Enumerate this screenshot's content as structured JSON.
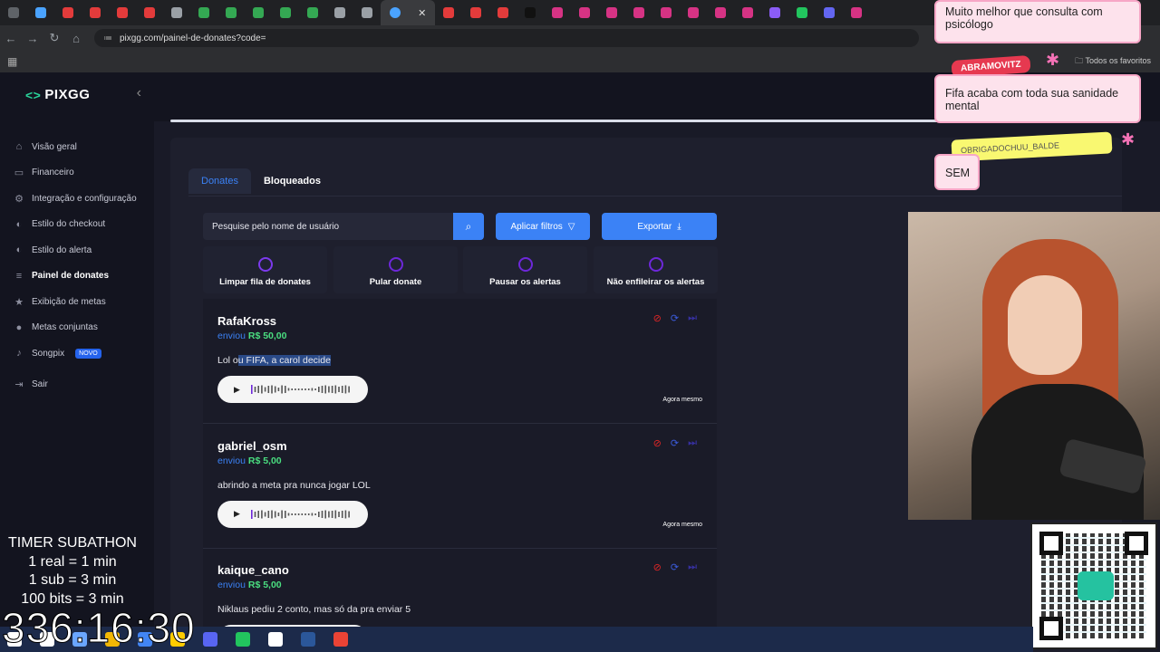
{
  "browser": {
    "url": "pixgg.com/painel-de-donates?code=",
    "bookmarks_all": "Todos os favoritos",
    "tab_colors": [
      "#5f6368",
      "#4aa3ff",
      "#e33b3b",
      "#e33b3b",
      "#e33b3b",
      "#e33b3b",
      "#9aa0a6",
      "#34a853",
      "#34a853",
      "#34a853",
      "#34a853",
      "#34a853",
      "#9aa0a6",
      "#9aa0a6",
      "#e33b3b",
      "#e33b3b",
      "#e33b3b",
      "#111111",
      "#d63384",
      "#d63384",
      "#d63384",
      "#d63384",
      "#d63384",
      "#d63384",
      "#d63384",
      "#d63384",
      "#8b5cf6",
      "#22c55e",
      "#6366f1",
      "#d63384"
    ]
  },
  "sidebar": {
    "brand": "PIXGG",
    "items": [
      {
        "label": "Visão geral",
        "icon": "home-icon",
        "glyph": "⌂"
      },
      {
        "label": "Financeiro",
        "icon": "wallet-icon",
        "glyph": "▭"
      },
      {
        "label": "Integração e configuração",
        "icon": "link-icon",
        "glyph": "⚙"
      },
      {
        "label": "Estilo do checkout",
        "icon": "palette-icon",
        "glyph": "◐"
      },
      {
        "label": "Estilo do alerta",
        "icon": "palette-icon",
        "glyph": "◐"
      },
      {
        "label": "Painel de donates",
        "icon": "list-icon",
        "glyph": "≡"
      },
      {
        "label": "Exibição de metas",
        "icon": "star-icon",
        "glyph": "★"
      },
      {
        "label": "Metas conjuntas",
        "icon": "users-icon",
        "glyph": "●"
      },
      {
        "label": "Songpix",
        "icon": "music-icon",
        "glyph": "♪",
        "badge": "NOVO"
      },
      {
        "label": "Sair",
        "icon": "logout-icon",
        "glyph": "⇥"
      }
    ],
    "active_index": 5
  },
  "panel": {
    "tabs": [
      "Donates",
      "Bloqueados"
    ],
    "search_placeholder": "Pesquise pelo nome de usuário",
    "filter_label": "Aplicar filtros",
    "export_label": "Exportar",
    "actions": [
      {
        "label": "Limpar fila de donates",
        "icon": "eraser-icon",
        "color": "#7c3aed"
      },
      {
        "label": "Pular donate",
        "icon": "skip-icon",
        "color": "#6d28d9"
      },
      {
        "label": "Pausar os alertas",
        "icon": "pause-icon",
        "color": "#6d28d9"
      },
      {
        "label": "Não enfileirar os alertas",
        "icon": "bell-off-icon",
        "color": "#6d28d9"
      }
    ],
    "donates": [
      {
        "user": "RafaKross",
        "sent": "enviou",
        "amount": "R$ 50,00",
        "msg_plain": "Lol o",
        "msg_hl": "u FIFA, a carol decide",
        "time": "Agora mesmo"
      },
      {
        "user": "gabriel_osm",
        "sent": "enviou",
        "amount": "R$ 5,00",
        "msg_plain": "abrindo a meta pra nunca jogar LOL",
        "msg_hl": "",
        "time": "Agora mesmo"
      },
      {
        "user": "kaique_cano",
        "sent": "enviou",
        "amount": "R$ 5,00",
        "msg_plain": "Niklaus pediu 2 conto, mas só da pra enviar 5",
        "msg_hl": "",
        "time": ""
      }
    ]
  },
  "overlay": {
    "chat": [
      {
        "text": "Muito melhor que consulta com psicólogo"
      },
      {
        "name": "ABRAMOVITZ",
        "text": "Fifa acaba com toda sua sanidade mental"
      },
      {
        "name": "OBRIGADOCHUU_BALDE",
        "text": "SEM"
      }
    ],
    "timer_lines": [
      "TIMER SUBATHON",
      "1 real = 1 min",
      "1 sub = 3 min",
      "100 bits = 3 min"
    ],
    "timer_value": "336:16:30"
  },
  "taskbar": {
    "icon_colors": [
      "#ffffff",
      "#ffffff",
      "#6aa6ff",
      "#f2b705",
      "#4285f4",
      "#ffcc00",
      "#5865f2",
      "#22c55e",
      "#ffffff",
      "#2b579a",
      "#ea4335"
    ]
  }
}
